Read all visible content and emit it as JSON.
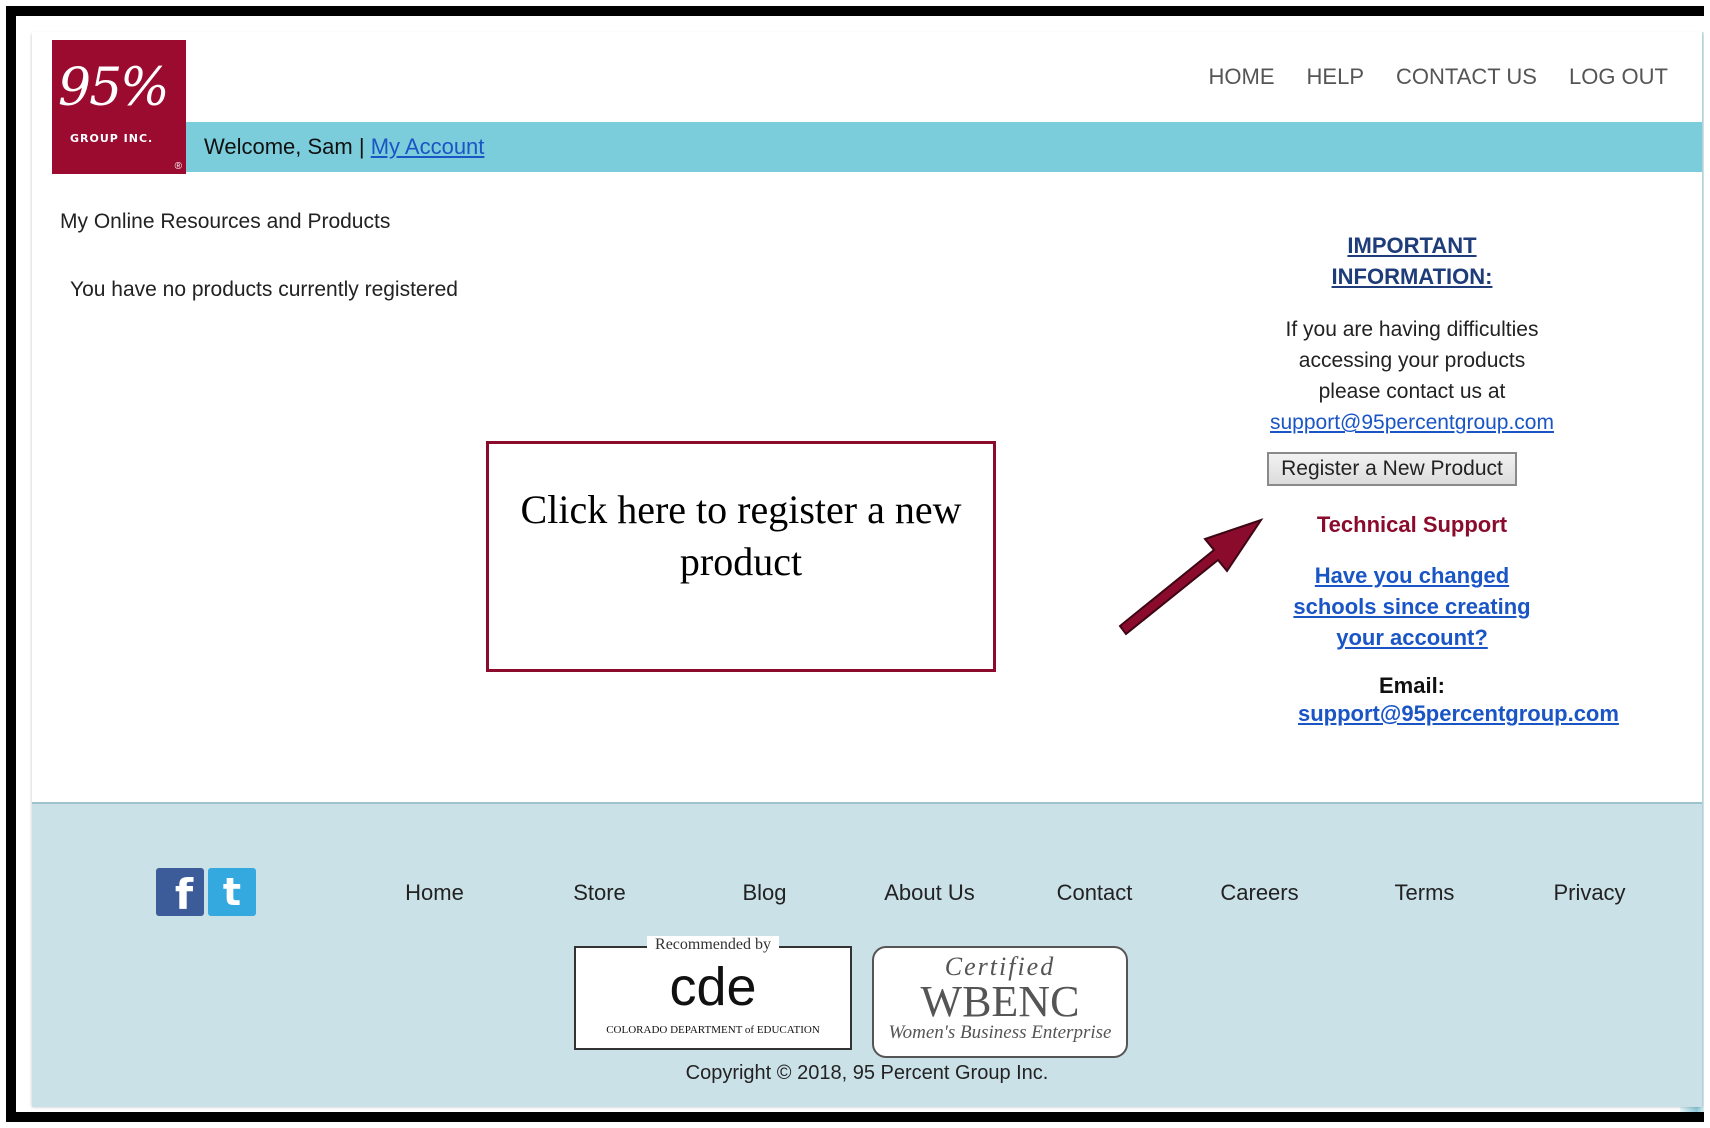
{
  "logo": {
    "mark": "95%",
    "sub": "GROUP INC.",
    "reg": "®"
  },
  "topnav": {
    "home": "HOME",
    "help": "HELP",
    "contact": "CONTACT US",
    "logout": "LOG OUT"
  },
  "welcome": {
    "greeting": "Welcome, Sam | ",
    "account_link": "My Account"
  },
  "main": {
    "section_title": "My Online Resources and Products",
    "empty_message": "You have no products currently registered"
  },
  "callout": {
    "text": "Click here to register a new product",
    "border_color": "#8b0b2c"
  },
  "sidebar": {
    "important_line1": "IMPORTANT",
    "important_line2": "INFORMATION:",
    "help_text_lines": [
      "If you are having difficulties",
      "accessing your products",
      "please contact us at"
    ],
    "support_email": "support@95percentgroup.com",
    "register_button": "Register a New Product",
    "tech_support_title": "Technical Support",
    "changed_schools_lines": [
      "Have you changed",
      "schools since creating",
      "your account?"
    ],
    "email_label": "Email:",
    "email_link": "support@95percentgroup.com"
  },
  "footer": {
    "social": {
      "facebook_icon": "f",
      "twitter_icon": "t"
    },
    "links": [
      "Home",
      "Store",
      "Blog",
      "About Us",
      "Contact",
      "Careers",
      "Terms",
      "Privacy"
    ],
    "cde_badge": {
      "recommended": "Recommended by",
      "logo_text": "cde",
      "department": "COLORADO DEPARTMENT of EDUCATION"
    },
    "wbenc_badge": {
      "certified": "Certified",
      "logo_text": "WBENC",
      "subtitle": "Women's Business Enterprise"
    },
    "copyright": "Copyright © 2018, 95 Percent Group Inc."
  },
  "colors": {
    "brand_maroon": "#9a0b2f",
    "welcome_bar": "#7ccddb",
    "footer_bg": "#cbe1e8",
    "link_blue": "#1a55c6"
  }
}
